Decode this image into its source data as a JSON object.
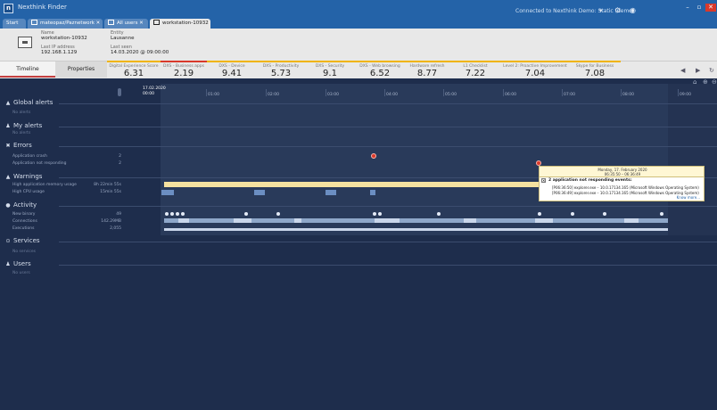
{
  "app": {
    "title": "Nexthink Finder",
    "connection": "Connected to Nexthink Demo: Static (demo)"
  },
  "tabs": [
    {
      "label": "Start",
      "active": false
    },
    {
      "label": "mateopaz/Paznetwork",
      "active": false
    },
    {
      "label": "All users",
      "active": false
    },
    {
      "label": "workstation-10932",
      "active": true
    }
  ],
  "device": {
    "name_label": "Name",
    "name": "workstation-10932",
    "ip_label": "Last IP address",
    "ip": "192.168.1.129",
    "entity_label": "Entity",
    "entity": "Lausanne",
    "seen_label": "Last seen",
    "seen": "14.03.2020 @ 09:00:00"
  },
  "view_tabs": {
    "timeline": "Timeline",
    "properties": "Properties"
  },
  "scores": [
    {
      "label": "Digital Experience Score",
      "value": "6.31"
    },
    {
      "label": "DXS - Business apps",
      "value": "2.19"
    },
    {
      "label": "DXS - Device",
      "value": "9.41"
    },
    {
      "label": "DXS - Productivity",
      "value": "5.73"
    },
    {
      "label": "DXS - Security",
      "value": "9.1"
    },
    {
      "label": "DXS - Web browsing",
      "value": "6.52"
    },
    {
      "label": "Hardware refresh",
      "value": "8.77"
    },
    {
      "label": "L1 Checklist",
      "value": "7.22"
    },
    {
      "label": "Level 2: Proactive Improvement",
      "value": "7.04"
    },
    {
      "label": "Skype for Business",
      "value": "7.08"
    }
  ],
  "timeline": {
    "date": "17.02.2020",
    "start": "00:00",
    "hours": [
      "01:00",
      "02:00",
      "03:00",
      "04:00",
      "05:00",
      "06:00",
      "07:00",
      "08:00",
      "09:00"
    ]
  },
  "sections": {
    "global_alerts": {
      "title": "Global alerts",
      "empty": "No alerts"
    },
    "my_alerts": {
      "title": "My alerts",
      "empty": "No alerts"
    },
    "errors": {
      "title": "Errors",
      "rows": [
        {
          "label": "Application crash",
          "value": "2"
        },
        {
          "label": "Application not responding",
          "value": "2"
        }
      ]
    },
    "warnings": {
      "title": "Warnings",
      "rows": [
        {
          "label": "High application memory usage",
          "value": "8h 22min 55s"
        },
        {
          "label": "High CPU usage",
          "value": "15min 55s"
        }
      ]
    },
    "activity": {
      "title": "Activity",
      "rows": [
        {
          "label": "New binary",
          "value": "49"
        },
        {
          "label": "Connections",
          "value": "142.29MB"
        },
        {
          "label": "Executions",
          "value": "2,055"
        }
      ]
    },
    "services": {
      "title": "Services",
      "empty": "No services"
    },
    "users": {
      "title": "Users",
      "empty": "No users"
    }
  },
  "popup": {
    "date": "Monday, 17. February 2020",
    "range": "06:35:50 – 06:36:49",
    "title": "2 application not responding events:",
    "lines": [
      "[P06:36:50] explorer.exe – 10.0.17134.165 (Microsoft Windows Operating System)",
      "[P06:36:49] explorer.exe – 10.0.17134.165 (Microsoft Windows Operating System)"
    ],
    "more": "Know more..."
  },
  "colors": {
    "titlebar": "#2463a8",
    "background": "#1e2d4c",
    "error": "#d9392b",
    "warning": "#f5e2a0",
    "accent": "#f0b400"
  }
}
